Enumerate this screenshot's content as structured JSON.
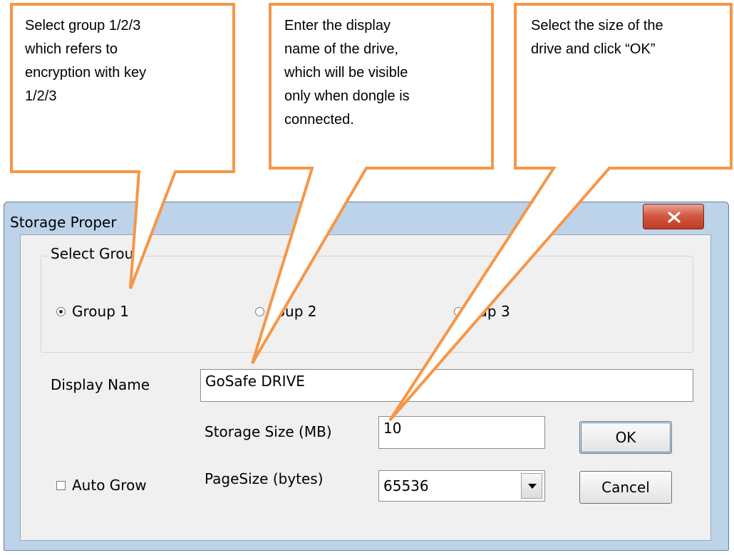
{
  "dialog": {
    "title": "Storage Proper",
    "close_icon": "close-x-icon",
    "group_box_label": "Select Group",
    "groups": [
      {
        "label": "Group 1",
        "checked": true
      },
      {
        "label": "roup 2",
        "checked": false
      },
      {
        "label": "oup 3",
        "checked": false
      }
    ],
    "display_name_label": "Display Name",
    "display_name_value": "GoSafe DRIVE",
    "storage_size_label": "Storage Size (MB)",
    "storage_size_value": "10",
    "page_size_label": "PageSize (bytes)",
    "page_size_value": "65536",
    "auto_grow_label": "Auto Grow",
    "auto_grow_checked": false,
    "ok_label": "OK",
    "cancel_label": "Cancel"
  },
  "callouts": [
    {
      "lines": [
        "Select group 1/2/3",
        "which refers to",
        "encryption with key",
        "1/2/3"
      ]
    },
    {
      "lines": [
        "Enter the display",
        "name of the drive,",
        "which will  be visible",
        "only when dongle is",
        "connected."
      ]
    },
    {
      "lines": [
        "Select the size of the",
        "drive and click “OK”"
      ]
    }
  ],
  "colors": {
    "callout_border": "#f79646",
    "window_frame": "#bcd3ea",
    "close_button": "#c23a22"
  }
}
